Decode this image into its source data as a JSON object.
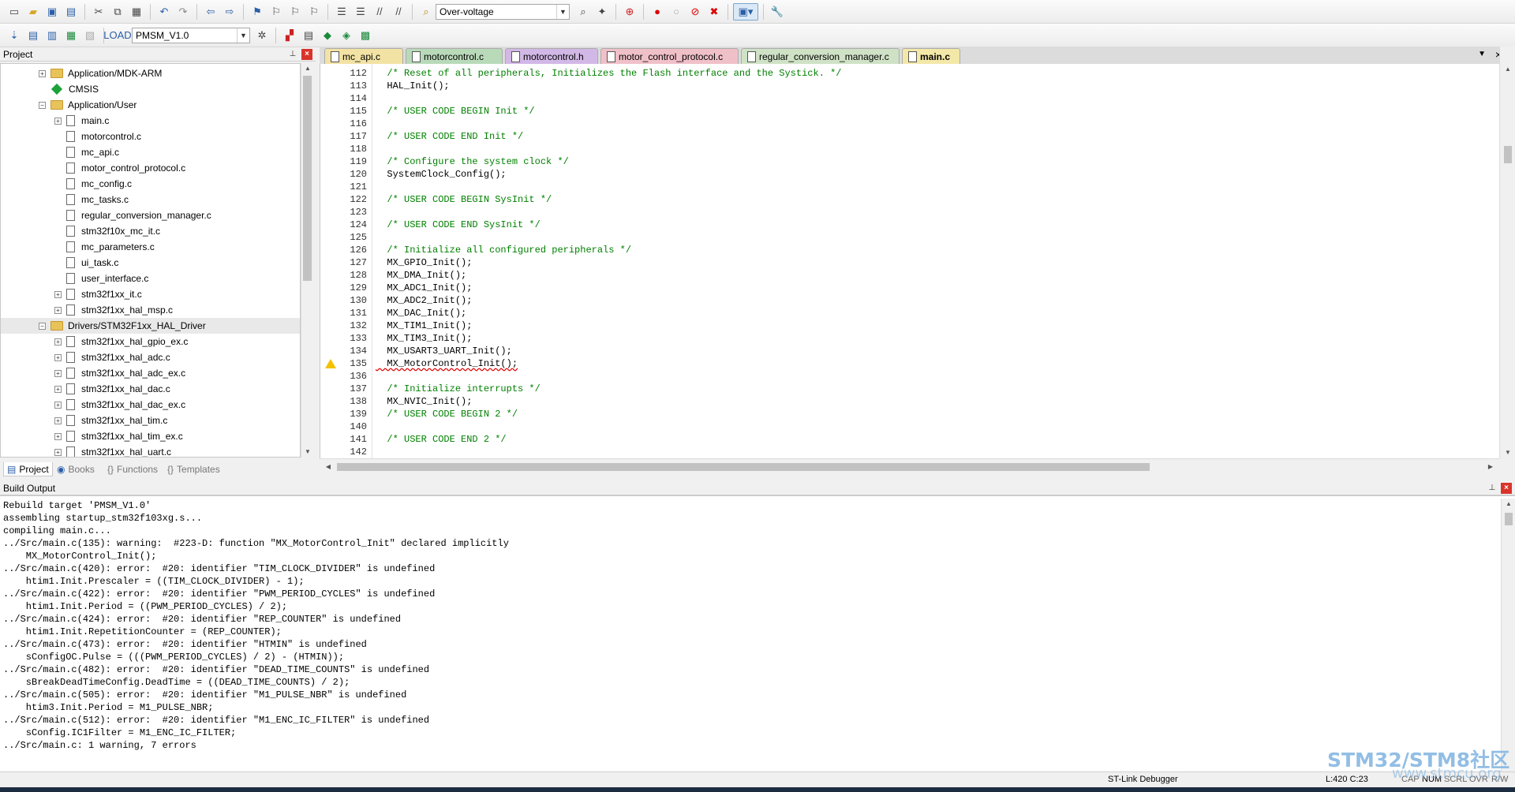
{
  "toolbar1": {
    "target_combo": "Over-voltage"
  },
  "toolbar2": {
    "project_combo": "PMSM_V1.0"
  },
  "project_panel": {
    "title": "Project",
    "tree": [
      {
        "label": "Application/MDK-ARM",
        "kind": "folder",
        "expand": "+"
      },
      {
        "label": "CMSIS",
        "kind": "component",
        "expand": ""
      },
      {
        "label": "Application/User",
        "kind": "folder",
        "expand": "-"
      },
      {
        "label": "main.c",
        "kind": "file",
        "expand": "+"
      },
      {
        "label": "motorcontrol.c",
        "kind": "file",
        "expand": ""
      },
      {
        "label": "mc_api.c",
        "kind": "file",
        "expand": ""
      },
      {
        "label": "motor_control_protocol.c",
        "kind": "file",
        "expand": ""
      },
      {
        "label": "mc_config.c",
        "kind": "file",
        "expand": ""
      },
      {
        "label": "mc_tasks.c",
        "kind": "file",
        "expand": ""
      },
      {
        "label": "regular_conversion_manager.c",
        "kind": "file",
        "expand": ""
      },
      {
        "label": "stm32f10x_mc_it.c",
        "kind": "file",
        "expand": ""
      },
      {
        "label": "mc_parameters.c",
        "kind": "file",
        "expand": ""
      },
      {
        "label": "ui_task.c",
        "kind": "file",
        "expand": ""
      },
      {
        "label": "user_interface.c",
        "kind": "file",
        "expand": ""
      },
      {
        "label": "stm32f1xx_it.c",
        "kind": "file",
        "expand": "+"
      },
      {
        "label": "stm32f1xx_hal_msp.c",
        "kind": "file",
        "expand": "+"
      },
      {
        "label": "Drivers/STM32F1xx_HAL_Driver",
        "kind": "folder",
        "expand": "-"
      },
      {
        "label": "stm32f1xx_hal_gpio_ex.c",
        "kind": "file",
        "expand": "+"
      },
      {
        "label": "stm32f1xx_hal_adc.c",
        "kind": "file",
        "expand": "+"
      },
      {
        "label": "stm32f1xx_hal_adc_ex.c",
        "kind": "file",
        "expand": "+"
      },
      {
        "label": "stm32f1xx_hal_dac.c",
        "kind": "file",
        "expand": "+"
      },
      {
        "label": "stm32f1xx_hal_dac_ex.c",
        "kind": "file",
        "expand": "+"
      },
      {
        "label": "stm32f1xx_hal_tim.c",
        "kind": "file",
        "expand": "+"
      },
      {
        "label": "stm32f1xx_hal_tim_ex.c",
        "kind": "file",
        "expand": "+"
      },
      {
        "label": "stm32f1xx_hal_uart.c",
        "kind": "file",
        "expand": "+"
      }
    ],
    "tabs": [
      "Project",
      "Books",
      "Functions",
      "Templates"
    ]
  },
  "editor": {
    "tabs": [
      {
        "label": "mc_api.c",
        "color": "#f2e2a4"
      },
      {
        "label": "motorcontrol.c",
        "color": "#b9dab9"
      },
      {
        "label": "motorcontrol.h",
        "color": "#d2b8e6"
      },
      {
        "label": "motor_control_protocol.c",
        "color": "#f0c0c8"
      },
      {
        "label": "regular_conversion_manager.c",
        "color": "#cfe2c6"
      },
      {
        "label": "main.c",
        "color": "#f3e8a8"
      }
    ],
    "lines": [
      {
        "n": "112",
        "text": "  /* Reset of all peripherals, Initializes the Flash interface and the Systick. */",
        "comment": true
      },
      {
        "n": "113",
        "text": "  HAL_Init();",
        "comment": false
      },
      {
        "n": "114",
        "text": "",
        "comment": false
      },
      {
        "n": "115",
        "text": "  /* USER CODE BEGIN Init */",
        "comment": true
      },
      {
        "n": "116",
        "text": "",
        "comment": false
      },
      {
        "n": "117",
        "text": "  /* USER CODE END Init */",
        "comment": true
      },
      {
        "n": "118",
        "text": "",
        "comment": false
      },
      {
        "n": "119",
        "text": "  /* Configure the system clock */",
        "comment": true
      },
      {
        "n": "120",
        "text": "  SystemClock_Config();",
        "comment": false
      },
      {
        "n": "121",
        "text": "",
        "comment": false
      },
      {
        "n": "122",
        "text": "  /* USER CODE BEGIN SysInit */",
        "comment": true
      },
      {
        "n": "123",
        "text": "",
        "comment": false
      },
      {
        "n": "124",
        "text": "  /* USER CODE END SysInit */",
        "comment": true
      },
      {
        "n": "125",
        "text": "",
        "comment": false
      },
      {
        "n": "126",
        "text": "  /* Initialize all configured peripherals */",
        "comment": true
      },
      {
        "n": "127",
        "text": "  MX_GPIO_Init();",
        "comment": false
      },
      {
        "n": "128",
        "text": "  MX_DMA_Init();",
        "comment": false
      },
      {
        "n": "129",
        "text": "  MX_ADC1_Init();",
        "comment": false
      },
      {
        "n": "130",
        "text": "  MX_ADC2_Init();",
        "comment": false
      },
      {
        "n": "131",
        "text": "  MX_DAC_Init();",
        "comment": false
      },
      {
        "n": "132",
        "text": "  MX_TIM1_Init();",
        "comment": false
      },
      {
        "n": "133",
        "text": "  MX_TIM3_Init();",
        "comment": false
      },
      {
        "n": "134",
        "text": "  MX_USART3_UART_Init();",
        "comment": false
      },
      {
        "n": "135",
        "text": "  MX_MotorControl_Init();",
        "comment": false,
        "warning": true
      },
      {
        "n": "136",
        "text": "",
        "comment": false
      },
      {
        "n": "137",
        "text": "  /* Initialize interrupts */",
        "comment": true
      },
      {
        "n": "138",
        "text": "  MX_NVIC_Init();",
        "comment": false
      },
      {
        "n": "139",
        "text": "  /* USER CODE BEGIN 2 */",
        "comment": true
      },
      {
        "n": "140",
        "text": "",
        "comment": false
      },
      {
        "n": "141",
        "text": "  /* USER CODE END 2 */",
        "comment": true
      },
      {
        "n": "142",
        "text": "",
        "comment": false
      }
    ]
  },
  "build_output": {
    "title": "Build Output",
    "lines": [
      "Rebuild target 'PMSM_V1.0'",
      "assembling startup_stm32f103xg.s...",
      "compiling main.c...",
      "../Src/main.c(135): warning:  #223-D: function \"MX_MotorControl_Init\" declared implicitly",
      "    MX_MotorControl_Init();",
      "../Src/main.c(420): error:  #20: identifier \"TIM_CLOCK_DIVIDER\" is undefined",
      "    htim1.Init.Prescaler = ((TIM_CLOCK_DIVIDER) - 1);",
      "../Src/main.c(422): error:  #20: identifier \"PWM_PERIOD_CYCLES\" is undefined",
      "    htim1.Init.Period = ((PWM_PERIOD_CYCLES) / 2);",
      "../Src/main.c(424): error:  #20: identifier \"REP_COUNTER\" is undefined",
      "    htim1.Init.RepetitionCounter = (REP_COUNTER);",
      "../Src/main.c(473): error:  #20: identifier \"HTMIN\" is undefined",
      "    sConfigOC.Pulse = (((PWM_PERIOD_CYCLES) / 2) - (HTMIN));",
      "../Src/main.c(482): error:  #20: identifier \"DEAD_TIME_COUNTS\" is undefined",
      "    sBreakDeadTimeConfig.DeadTime = ((DEAD_TIME_COUNTS) / 2);",
      "../Src/main.c(505): error:  #20: identifier \"M1_PULSE_NBR\" is undefined",
      "    htim3.Init.Period = M1_PULSE_NBR;",
      "../Src/main.c(512): error:  #20: identifier \"M1_ENC_IC_FILTER\" is undefined",
      "    sConfig.IC1Filter = M1_ENC_IC_FILTER;",
      "../Src/main.c: 1 warning, 7 errors"
    ]
  },
  "status_bar": {
    "debugger": "ST-Link Debugger",
    "position": "L:420 C:23",
    "cap": "CAP",
    "num": "NUM",
    "scrl": "SCRL",
    "ovr": "OVR",
    "rw": "R/W"
  },
  "watermark": {
    "brand": "STM32/STM8社区",
    "url": "www.stmcu.org"
  }
}
